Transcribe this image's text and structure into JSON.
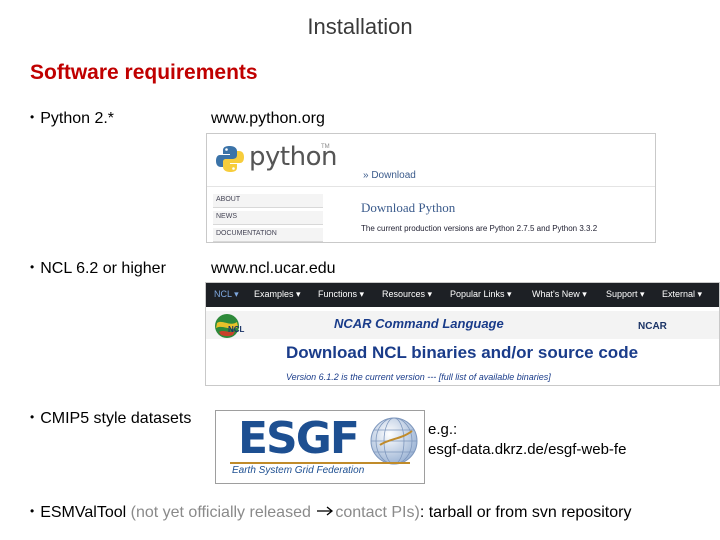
{
  "title": "Installation",
  "section_title": "Software requirements",
  "bullet_marker": "•",
  "requirements": [
    {
      "name": "Python 2.*",
      "url": "www.python.org"
    },
    {
      "name": "NCL 6.2 or higher",
      "url": "www.ncl.ucar.edu"
    },
    {
      "name": "CMIP5 style datasets",
      "example_label": "e.g.:",
      "example_url": "esgf-data.dkrz.de/esgf-web-fe"
    }
  ],
  "esmvaltool": {
    "name": "ESMValTool",
    "note_open": "(not yet officially released",
    "note_contact": "contact PIs)",
    "suffix": ": tarball or from svn repository",
    "arrow_icon": "arrow-right-icon"
  },
  "python_screenshot": {
    "wordmark": "python",
    "tm": "TM",
    "download_link": "» Download",
    "sidebar_items": [
      "ABOUT",
      "NEWS",
      "DOCUMENTATION"
    ],
    "heading": "Download Python",
    "text": "The current production versions are Python 2.7.5 and Python 3.3.2"
  },
  "ncl_screenshot": {
    "nav_items": [
      "NCL ▾",
      "Examples ▾",
      "Functions ▾",
      "Resources ▾",
      "Popular Links ▾",
      "What's New ▾",
      "Support ▾",
      "External ▾"
    ],
    "logo_text": "NCL",
    "title": "NCAR  Command  Language",
    "org": "NCAR",
    "heading": "Download NCL binaries and/or source code",
    "version_text": "Version 6.1.2 is the current version --- [full list of available binaries]"
  },
  "esgf_logo": {
    "wordmark": "ESGF",
    "subtitle": "Earth System Grid Federation"
  },
  "colors": {
    "section_title": "#c00000",
    "grey_text": "#8a8a8a",
    "esgf_blue": "#1d4f91",
    "ncl_blue": "#1a3c8a"
  }
}
